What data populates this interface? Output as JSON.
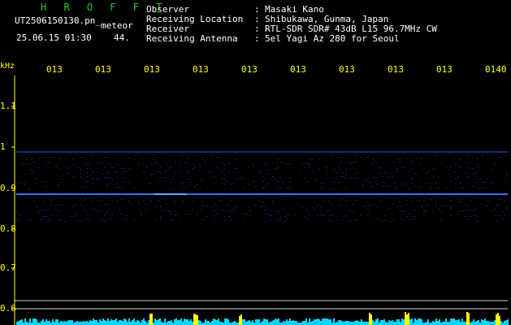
{
  "header": {
    "app_title": "H R O F F T",
    "file_name": "UT2506150130.pn_",
    "meteor_label": "meteor",
    "timestamp": "25.06.15 01:30",
    "count": "44.",
    "info": [
      {
        "label": "Observer",
        "value": "Masaki Kano"
      },
      {
        "label": "Receiving Location",
        "value": "Shibukawa, Gunma, Japan"
      },
      {
        "label": "Receiver",
        "value": "RTL-SDR SDR# 43dB L15 96.7MHz CW"
      },
      {
        "label": "Receiving Antenna",
        "value": "5el Yagi Az 280 for Seoul"
      }
    ]
  },
  "spectrogram": {
    "freq_unit": "kHz",
    "x_ticks": [
      "013",
      "013",
      "013",
      "013",
      "013",
      "013",
      "013",
      "013",
      "013",
      "0140"
    ],
    "y_ticks": [
      "1.1",
      "1",
      "0.9",
      "0.8",
      "0.7",
      "0.6"
    ],
    "signal_freq_khz": 0.88,
    "upper_band_khz": 0.98,
    "colors": {
      "background": "#000000",
      "signal": "#3a6bff",
      "noise_floor": "#00e0ff",
      "meteor_echo": "#ffff00",
      "text_accent": "#ffff00"
    }
  }
}
